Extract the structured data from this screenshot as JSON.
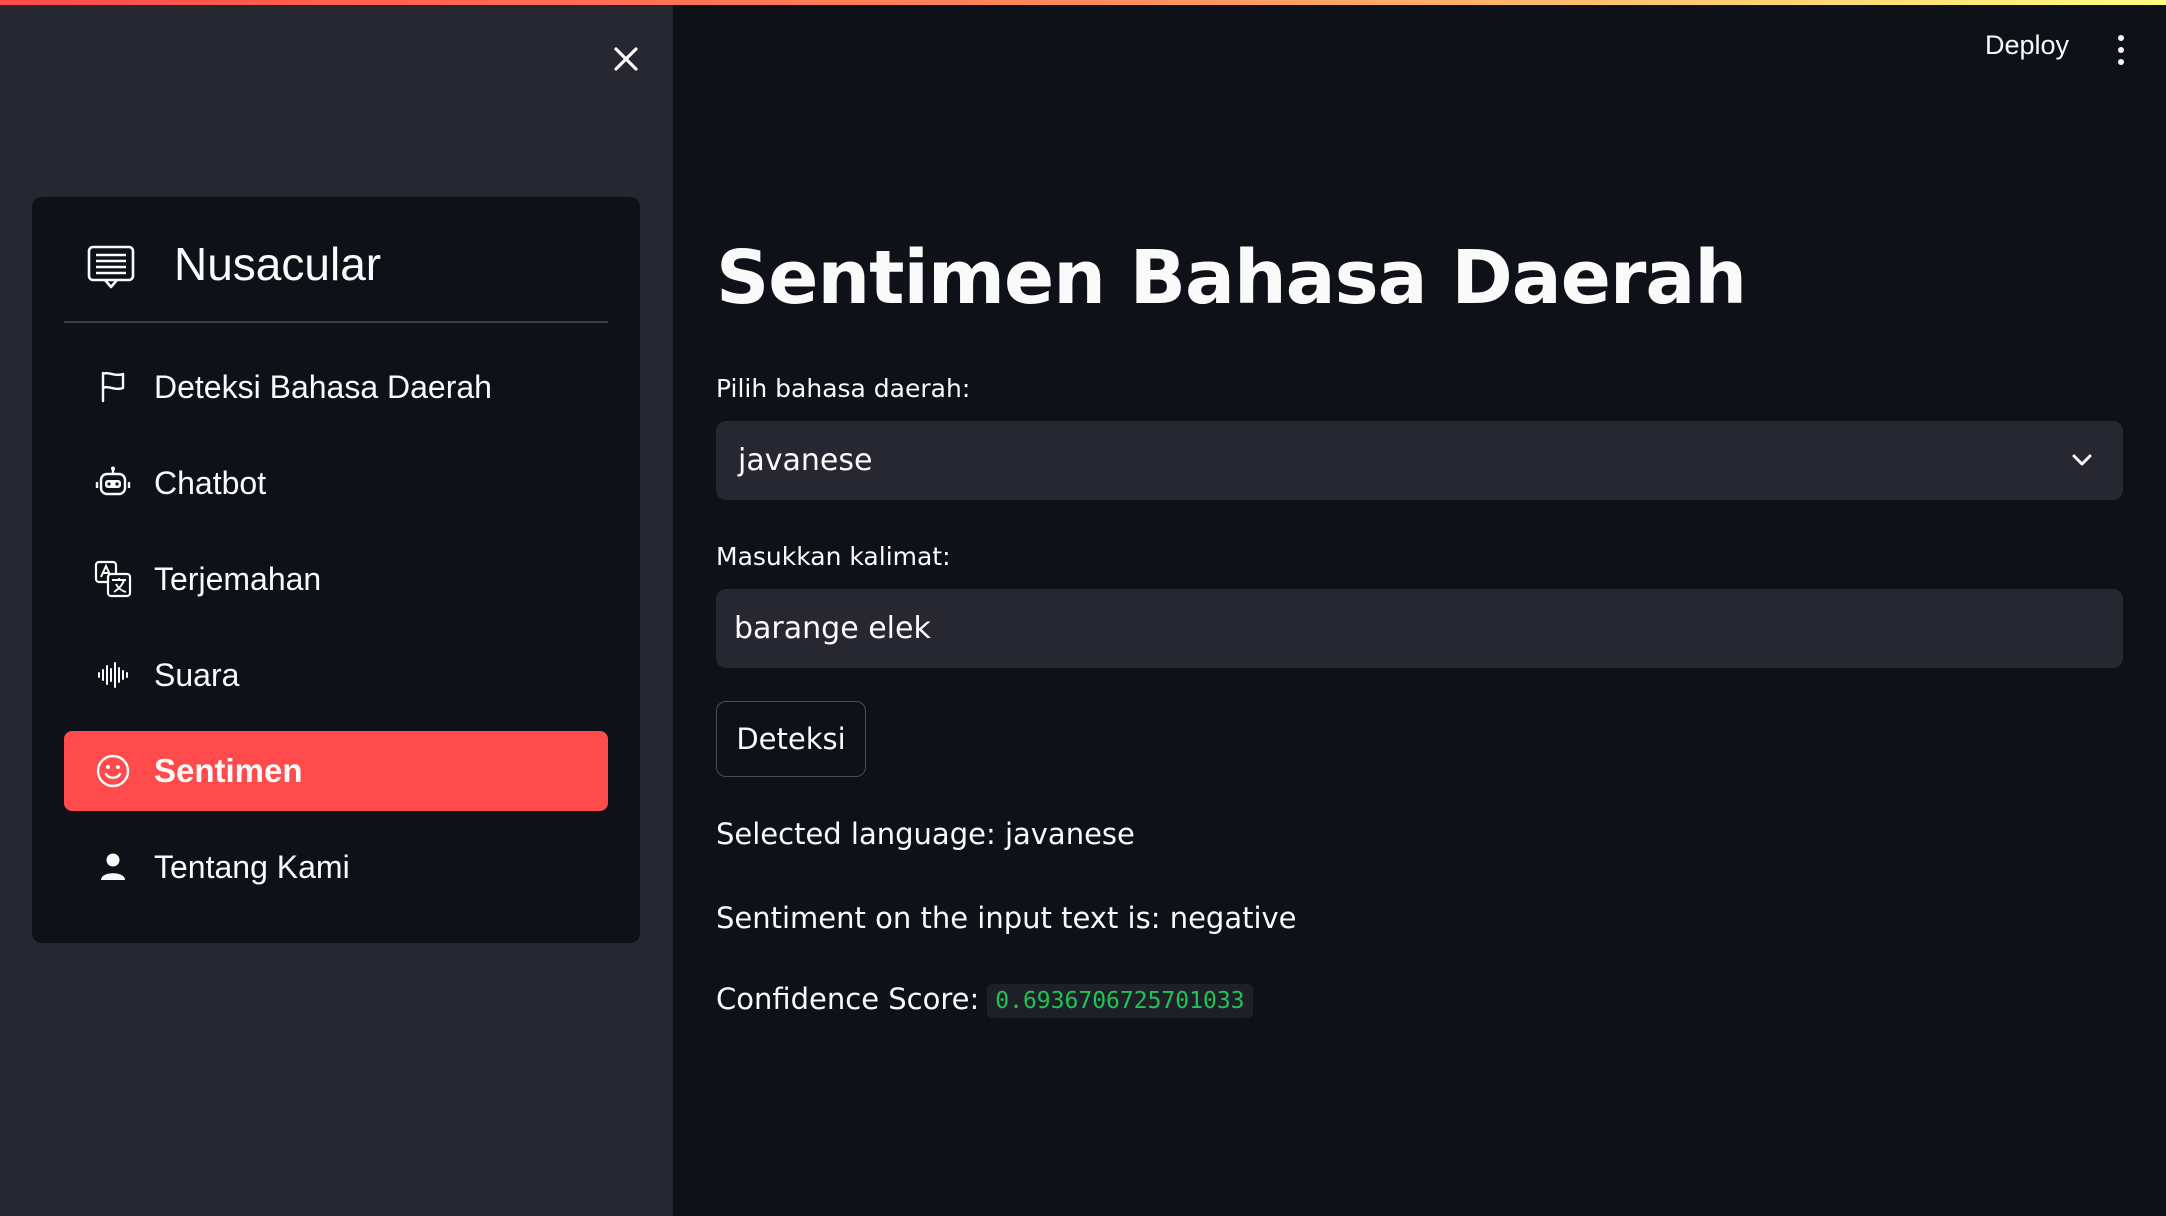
{
  "header": {
    "deploy_label": "Deploy",
    "menu_icon": "kebab-menu-icon"
  },
  "sidebar": {
    "close_icon": "close-icon",
    "menu_title": "Nusacular",
    "menu_icon": "message-list-icon",
    "items": [
      {
        "label": "Deteksi Bahasa Daerah",
        "icon": "flag-icon",
        "active": false
      },
      {
        "label": "Chatbot",
        "icon": "robot-icon",
        "active": false
      },
      {
        "label": "Terjemahan",
        "icon": "translate-icon",
        "active": false
      },
      {
        "label": "Suara",
        "icon": "soundwave-icon",
        "active": false
      },
      {
        "label": "Sentimen",
        "icon": "smiley-icon",
        "active": true
      },
      {
        "label": "Tentang Kami",
        "icon": "person-icon",
        "active": false
      }
    ],
    "active_color": "#ff4b4b"
  },
  "main": {
    "title": "Sentimen Bahasa Daerah",
    "language_label": "Pilih bahasa daerah:",
    "language_value": "javanese",
    "sentence_label": "Masukkan kalimat:",
    "sentence_value": "barange elek",
    "detect_button": "Deteksi",
    "selected_language_text": "Selected language: javanese",
    "sentiment_text": "Sentiment on the input text is: negative",
    "confidence_label": "Confidence Score:",
    "confidence_value": "0.6936706725701033"
  },
  "colors": {
    "background": "#0e1117",
    "sidebar": "#262730",
    "accent": "#ff4b4b",
    "code_text": "#21c354"
  }
}
